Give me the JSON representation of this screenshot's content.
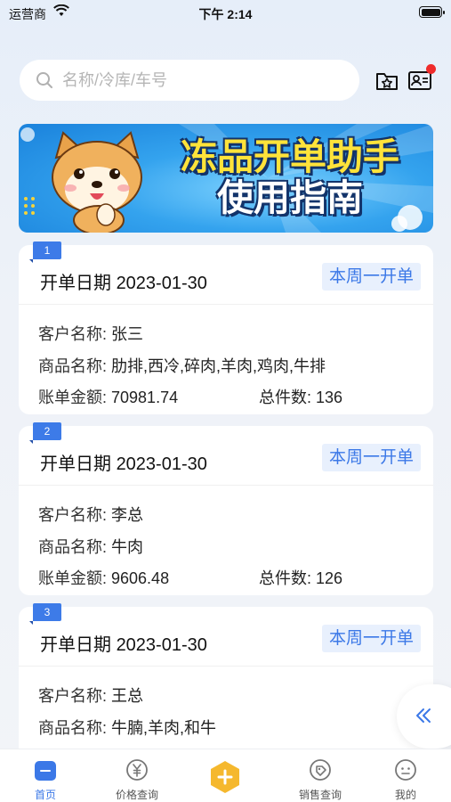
{
  "status_bar": {
    "carrier": "运营商",
    "time": "下午 2:14"
  },
  "search": {
    "placeholder": "名称/冷库/车号"
  },
  "banner": {
    "title_line1": "冻品开单助手",
    "title_line2": "使用指南"
  },
  "labels": {
    "date": "开单日期",
    "customer": "客户名称: ",
    "goods": "商品名称: ",
    "amount": "账单金额: ",
    "total": "总件数: "
  },
  "orders": [
    {
      "index": "1",
      "date": "2023-01-30",
      "tag": "本周一开单",
      "customer": "张三",
      "goods": "肋排,西冷,碎肉,羊肉,鸡肉,牛排",
      "amount": "70981.74",
      "total": "136"
    },
    {
      "index": "2",
      "date": "2023-01-30",
      "tag": "本周一开单",
      "customer": "李总",
      "goods": "牛肉",
      "amount": "9606.48",
      "total": "126"
    },
    {
      "index": "3",
      "date": "2023-01-30",
      "tag": "本周一开单",
      "customer": "王总",
      "goods": "牛腩,羊肉,和牛",
      "amount": "",
      "total": ""
    }
  ],
  "tabbar": {
    "home": "首页",
    "price": "价格查询",
    "sales": "销售查询",
    "mine": "我的"
  },
  "colors": {
    "accent": "#3b78e7",
    "badge": "#ef2b2b",
    "add_button": "#f5b82e"
  },
  "icons": [
    "wifi-icon",
    "battery-icon",
    "search-icon",
    "star-folder-icon",
    "contact-card-icon",
    "collapse-left-icon",
    "home-icon",
    "yen-icon",
    "add-icon",
    "tag-icon",
    "face-icon"
  ]
}
